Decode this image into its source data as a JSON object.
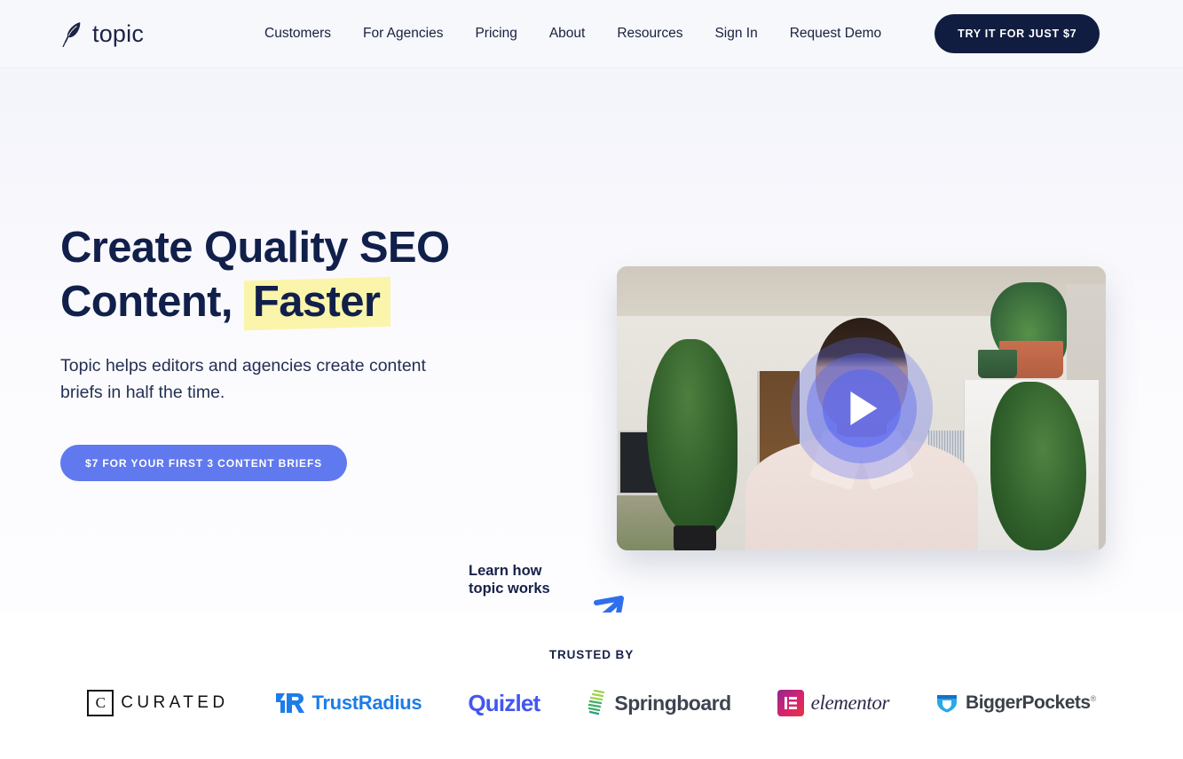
{
  "header": {
    "brand": {
      "name": "topic",
      "icon": "feather-quill-icon"
    },
    "nav": [
      {
        "label": "Customers"
      },
      {
        "label": "For Agencies"
      },
      {
        "label": "Pricing"
      },
      {
        "label": "About"
      },
      {
        "label": "Resources"
      },
      {
        "label": "Sign In"
      },
      {
        "label": "Request Demo"
      }
    ],
    "cta_label": "TRY IT FOR JUST $7"
  },
  "hero": {
    "headline_part1": "Create Quality SEO",
    "headline_part2": "Content, ",
    "headline_highlight": "Faster",
    "subhead": "Topic helps editors and agencies create content briefs in half the time.",
    "cta_label": "$7 FOR YOUR FIRST 3 CONTENT BRIEFS",
    "learn_text": "Learn how\ntopic works",
    "video": {
      "play_label": "Play video"
    }
  },
  "trusted": {
    "label": "TRUSTED BY",
    "logos": [
      {
        "name": "Curated",
        "mark": "C",
        "word": "CURATED"
      },
      {
        "name": "TrustRadius",
        "word": "TrustRadius"
      },
      {
        "name": "Quizlet",
        "word": "Quizlet"
      },
      {
        "name": "Springboard",
        "word": "Springboard"
      },
      {
        "name": "Elementor",
        "word": "elementor"
      },
      {
        "name": "BiggerPockets",
        "word": "BiggerPockets",
        "reg": "®"
      }
    ]
  },
  "colors": {
    "navy": "#111d40",
    "accent_blue": "#6079ef",
    "arrow_blue": "#2f6fee",
    "highlight_yellow": "#faf5ab",
    "page_bg": "#f8f8fd"
  }
}
